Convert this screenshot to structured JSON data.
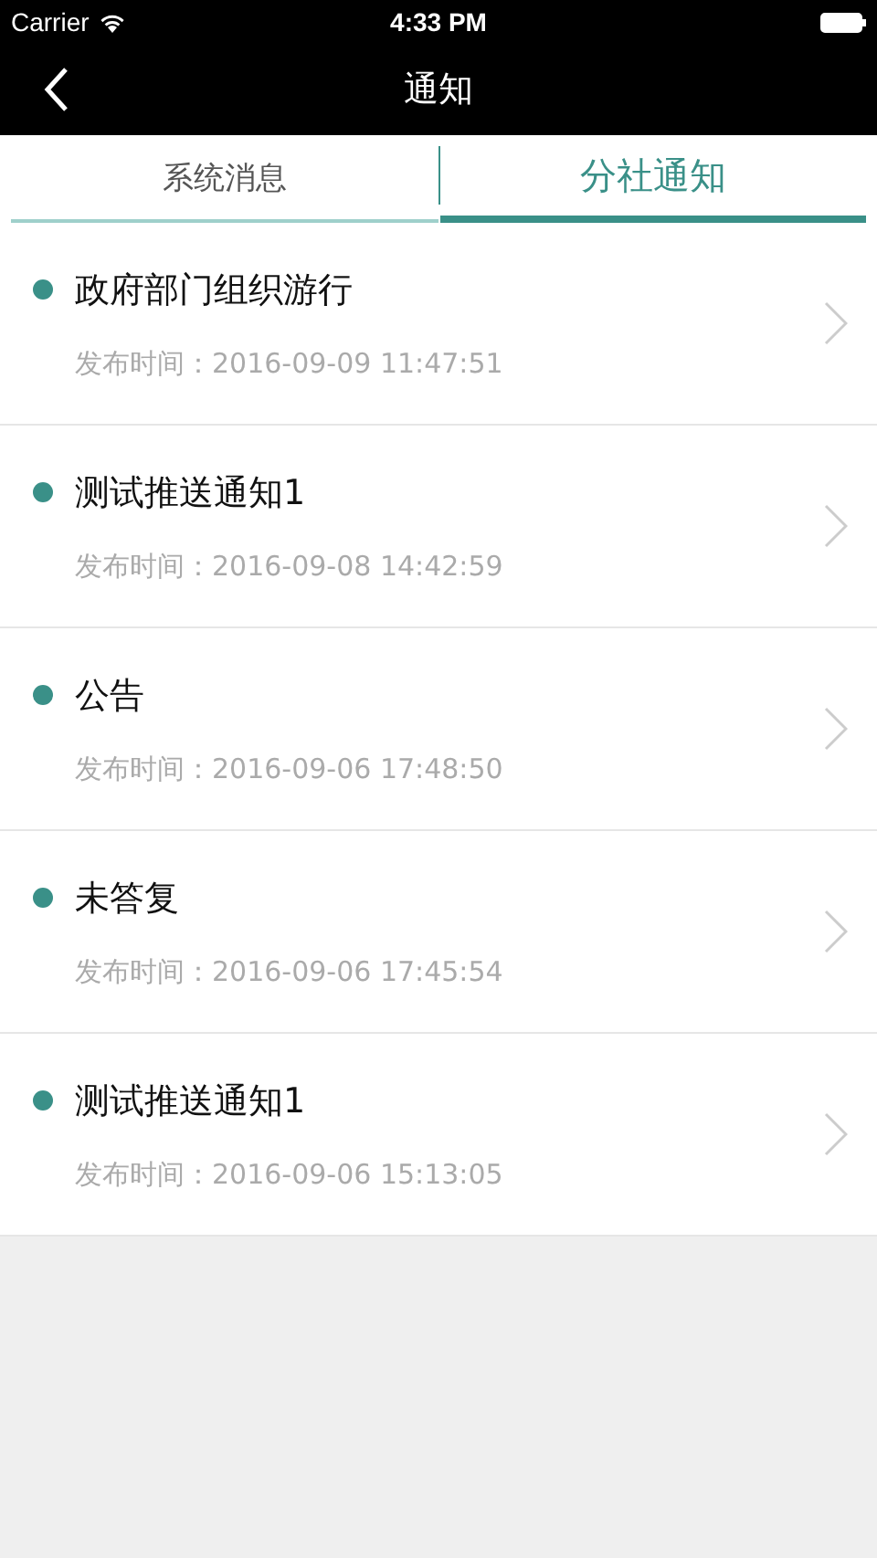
{
  "status_bar": {
    "carrier": "Carrier",
    "time": "4:33 PM"
  },
  "nav": {
    "title": "通知"
  },
  "tabs": [
    {
      "label": "系统消息",
      "selected": false
    },
    {
      "label": "分社通知",
      "selected": true
    }
  ],
  "notices": [
    {
      "title": "政府部门组织游行",
      "time": "发布时间：2016-09-09 11:47:51",
      "unread": true
    },
    {
      "title": "测试推送通知1",
      "time": "发布时间：2016-09-08 14:42:59",
      "unread": true
    },
    {
      "title": "公告",
      "time": "发布时间：2016-09-06 17:48:50",
      "unread": true
    },
    {
      "title": "未答复",
      "time": "发布时间：2016-09-06 17:45:54",
      "unread": true
    },
    {
      "title": "测试推送通知1",
      "time": "发布时间：2016-09-06 15:13:05",
      "unread": true
    }
  ]
}
